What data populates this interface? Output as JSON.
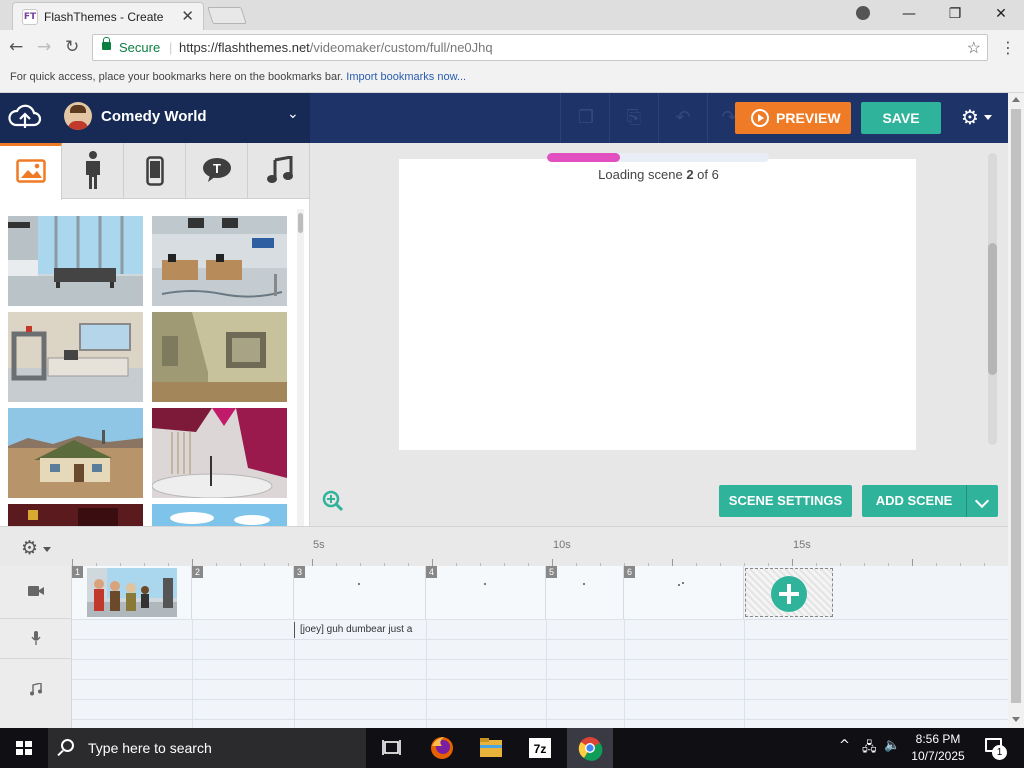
{
  "browser": {
    "tab_title": "FlashThemes - Create",
    "favicon_text": "FT",
    "secure_label": "Secure",
    "url_host": "https://flashthemes.net",
    "url_path": "/videomaker/custom/full/ne0Jhq",
    "bookmarks_hint": "For quick access, place your bookmarks here on the bookmarks bar.",
    "import_link": "Import bookmarks now..."
  },
  "header": {
    "theme_name": "Comedy World",
    "preview_label": "PREVIEW",
    "save_label": "SAVE",
    "colors": {
      "nav": "#1e3468",
      "preview": "#f07b26",
      "save": "#2fb39b"
    }
  },
  "asset_tabs": [
    {
      "name": "backgrounds",
      "icon": "image-icon"
    },
    {
      "name": "characters",
      "icon": "person-icon"
    },
    {
      "name": "props",
      "icon": "phone-icon"
    },
    {
      "name": "text",
      "icon": "speech-bubble-icon"
    },
    {
      "name": "sounds",
      "icon": "music-note-icon"
    }
  ],
  "stage": {
    "loading_prefix": "Loading scene ",
    "current_scene": "2",
    "loading_middle": " of ",
    "total_scenes": "6",
    "progress": 0.33,
    "scene_settings_label": "SCENE SETTINGS",
    "add_scene_label": "ADD SCENE"
  },
  "timeline": {
    "ruler_labels": [
      "5s",
      "10s",
      "15s"
    ],
    "scene_numbers": [
      "1",
      "2",
      "3",
      "4",
      "5",
      "6"
    ],
    "voice_clip": "[joey] guh dumbear just a"
  },
  "taskbar": {
    "search_placeholder": "Type here to search",
    "time": "8:56 PM",
    "date": "10/7/2025",
    "notification_count": "1"
  }
}
